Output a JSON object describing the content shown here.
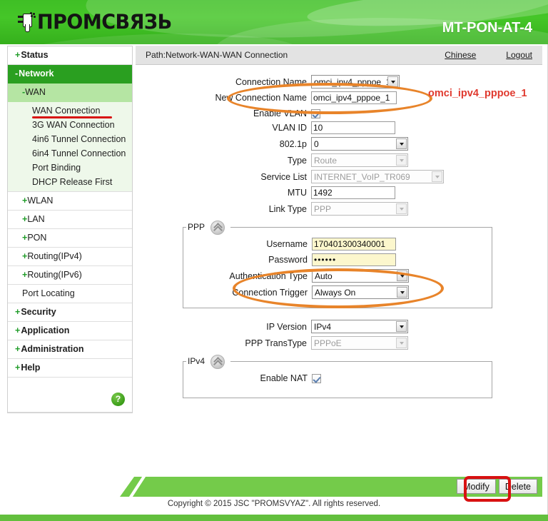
{
  "header": {
    "brand": "ПРОМСВЯЗЬ",
    "model": "MT-PON-AT-4",
    "logo_icon": "plug-icon"
  },
  "sidebar": {
    "items": [
      {
        "label": "Status",
        "sign": "+",
        "level": 1,
        "state": "collapsed"
      },
      {
        "label": "Network",
        "sign": "-",
        "level": 1,
        "state": "expanded-active"
      },
      {
        "label": "WAN",
        "sign": "-",
        "level": 2,
        "state": "expanded-active"
      },
      {
        "label": "WAN Connection",
        "level": 3,
        "state": "current"
      },
      {
        "label": "3G WAN Connection",
        "level": 3
      },
      {
        "label": "4in6 Tunnel Connection",
        "level": 3
      },
      {
        "label": "6in4 Tunnel Connection",
        "level": 3
      },
      {
        "label": "Port Binding",
        "level": 3
      },
      {
        "label": "DHCP Release First",
        "level": 3
      },
      {
        "label": "WLAN",
        "sign": "+",
        "level": 2
      },
      {
        "label": "LAN",
        "sign": "+",
        "level": 2
      },
      {
        "label": "PON",
        "sign": "+",
        "level": 2
      },
      {
        "label": "Routing(IPv4)",
        "sign": "+",
        "level": 2
      },
      {
        "label": "Routing(IPv6)",
        "sign": "+",
        "level": 2
      },
      {
        "label": "Port Locating",
        "sign": "",
        "level": 2
      },
      {
        "label": "Security",
        "sign": "+",
        "level": 1
      },
      {
        "label": "Application",
        "sign": "+",
        "level": 1
      },
      {
        "label": "Administration",
        "sign": "+",
        "level": 1
      },
      {
        "label": "Help",
        "sign": "+",
        "level": 1
      }
    ],
    "help_button": "?"
  },
  "pathbar": {
    "path": "Path:Network-WAN-WAN Connection",
    "chinese_link": "Chinese",
    "logout_link": "Logout"
  },
  "form": {
    "connection_name": {
      "label": "Connection Name",
      "value": "omci_ipv4_pppoe_1",
      "display": "omci_ipv4_pppoe_1"
    },
    "new_connection_name": {
      "label": "New Connection Name",
      "value": "omci_ipv4_pppoe_1"
    },
    "enable_vlan": {
      "label": "Enable VLAN",
      "checked": true
    },
    "vlan_id": {
      "label": "VLAN ID",
      "value": "10"
    },
    "dot1p": {
      "label": "802.1p",
      "value": "0"
    },
    "type": {
      "label": "Type",
      "value": "Route",
      "disabled": true
    },
    "service_list": {
      "label": "Service List",
      "value": "INTERNET_VoIP_TR069",
      "disabled": true
    },
    "mtu": {
      "label": "MTU",
      "value": "1492"
    },
    "link_type": {
      "label": "Link Type",
      "value": "PPP",
      "disabled": true
    },
    "ip_version": {
      "label": "IP Version",
      "value": "IPv4"
    },
    "ppp_transtype": {
      "label": "PPP TransType",
      "value": "PPPoE",
      "disabled": true
    }
  },
  "ppp_section": {
    "legend": "PPP",
    "username": {
      "label": "Username",
      "value": "170401300340001"
    },
    "password": {
      "label": "Password",
      "value": "••••••"
    },
    "auth_type": {
      "label": "Authentication Type",
      "value": "Auto"
    },
    "conn_trigger": {
      "label": "Connection Trigger",
      "value": "Always On"
    }
  },
  "ipv4_section": {
    "legend": "IPv4",
    "enable_nat": {
      "label": "Enable NAT",
      "checked": true
    }
  },
  "annotations": {
    "connection_name_note": "omci_ipv4_pppoe_1",
    "highlight_color": "#e8842a",
    "note_color": "#e03a2f",
    "button_highlight_color": "#d81111"
  },
  "footer": {
    "modify_button": "Modify",
    "delete_button": "Delete",
    "copyright": "Copyright © 2015 JSC \"PROMSVYAZ\". All rights reserved."
  }
}
